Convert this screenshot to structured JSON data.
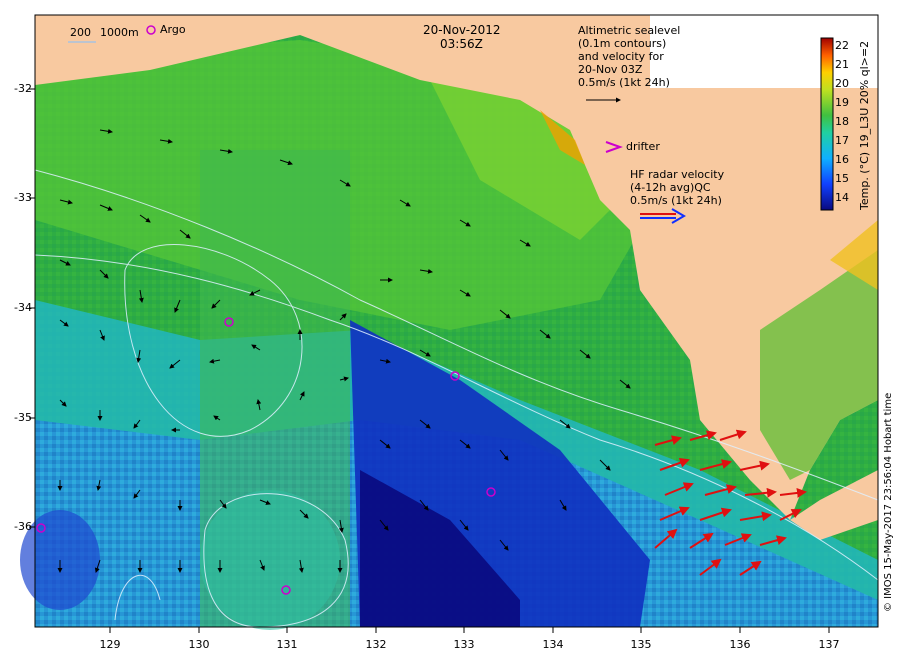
{
  "date": "20-Nov-2012",
  "time": "03:56Z",
  "legend": {
    "contour_200": "200",
    "contour_1000": "1000m",
    "argo_label": "Argo",
    "drifter_label": "drifter"
  },
  "altimetry": {
    "lines": [
      "Altimetric sealevel",
      "(0.1m contours)",
      "and velocity for",
      "20-Nov 03Z",
      "0.5m/s (1kt 24h)"
    ]
  },
  "hf_radar": {
    "lines": [
      "HF radar velocity",
      "(4-12h avg)QC",
      "0.5m/s (1kt 24h)"
    ]
  },
  "axes": {
    "x_ticks": [
      "129",
      "130",
      "131",
      "132",
      "133",
      "134",
      "135",
      "136",
      "137"
    ],
    "y_ticks": [
      "-32",
      "-33",
      "-34",
      "-35",
      "-36"
    ]
  },
  "colorbar": {
    "title": "Temp. (°C) 19_L3U 20% ql>=2",
    "ticks": [
      "22",
      "21",
      "20",
      "19",
      "18",
      "17",
      "16",
      "15",
      "14"
    ]
  },
  "credit": "© IMOS 15-May-2017 23:56:04 Hobart time",
  "colors": {
    "land": "#f8c9a0",
    "radar_arrow": "#e01010",
    "argo": "#cc00cc"
  }
}
